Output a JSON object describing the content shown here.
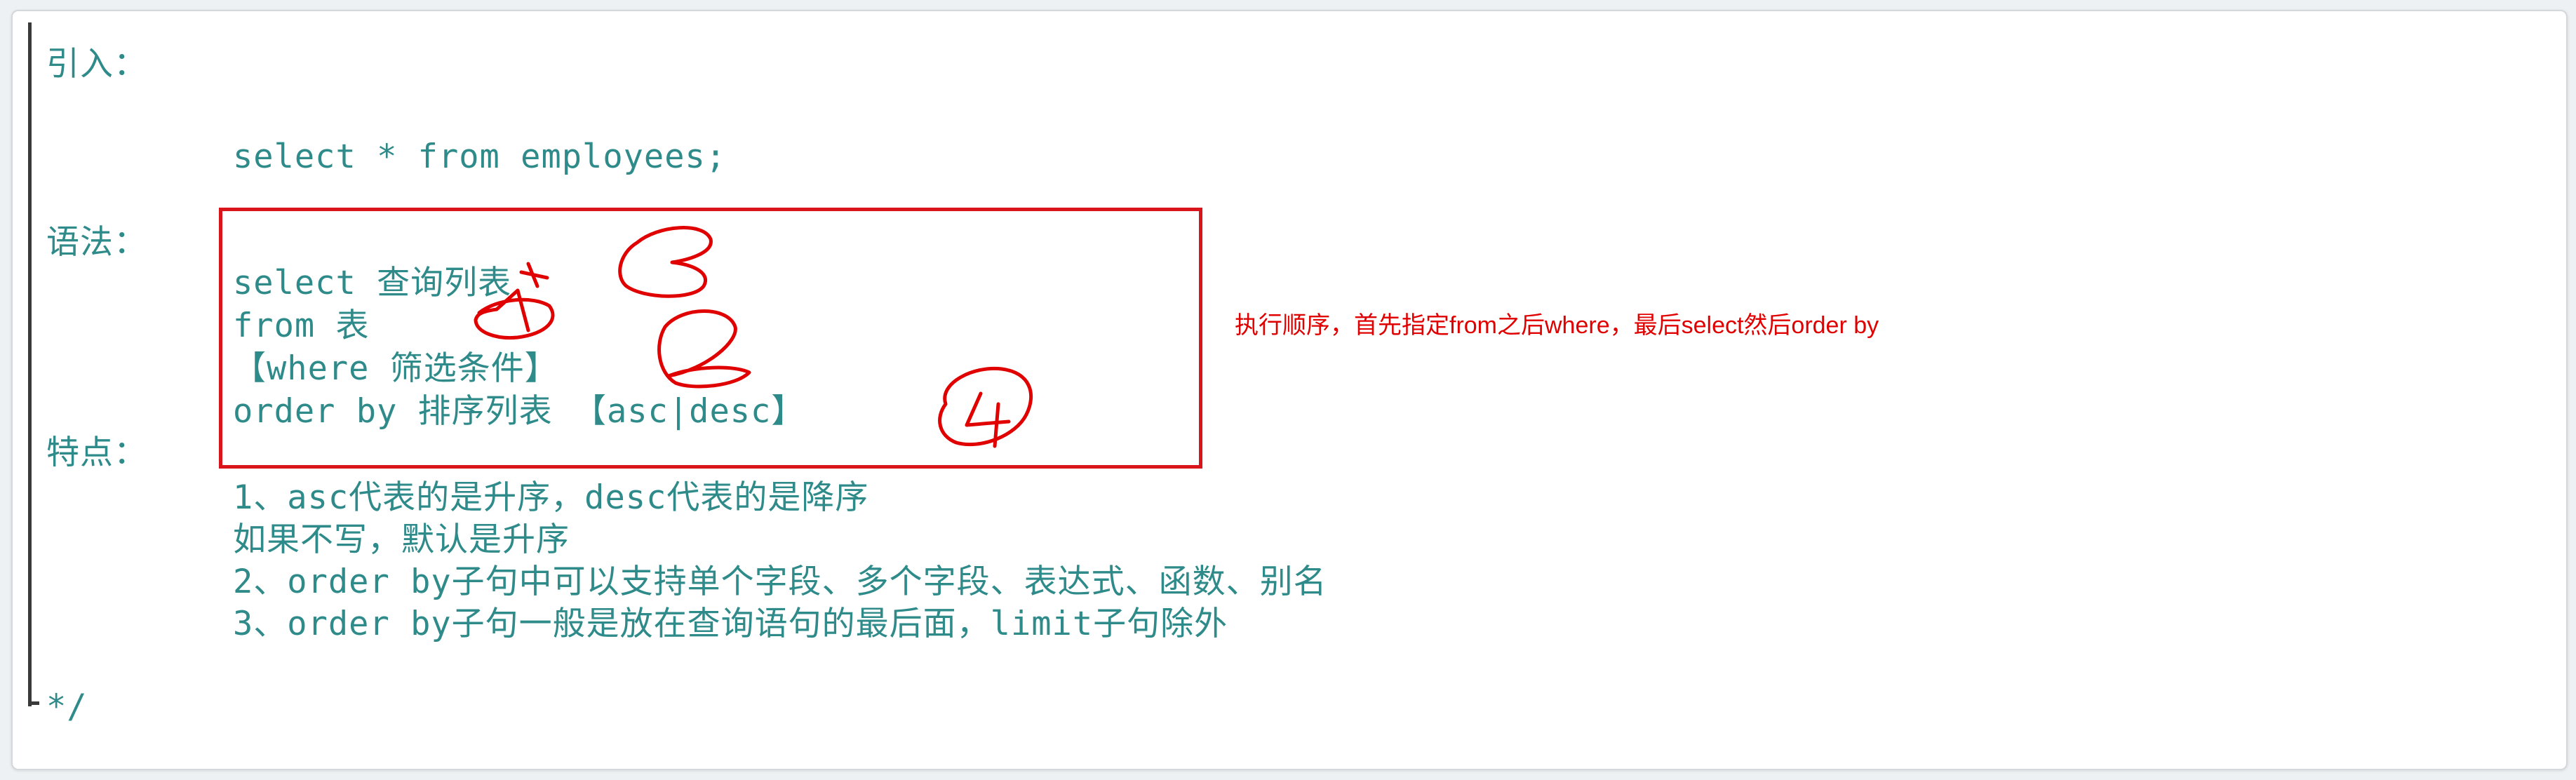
{
  "code": {
    "intro_label": "引入：",
    "intro_sql": "select * from employees;",
    "syntax_label": "语法：",
    "syntax_lines": [
      "select 查询列表",
      "from 表",
      "【where 筛选条件】",
      "order by 排序列表 【asc|desc】"
    ],
    "features_label": "特点：",
    "features": [
      "1、asc代表的是升序，desc代表的是降序",
      "如果不写，默认是升序",
      "2、order by子句中可以支持单个字段、多个字段、表达式、函数、别名",
      "3、order by子句一般是放在查询语句的最后面，limit子句除外"
    ],
    "comment_end": "*/"
  },
  "annotation": {
    "note": "执行顺序，首先指定from之后where，最后select然后order by",
    "handwritten_numbers": [
      "3",
      "1",
      "2",
      "4"
    ],
    "color": "#e00000"
  },
  "colors": {
    "code_text": "#2f8a8a",
    "highlight_box": "#d9141b"
  }
}
